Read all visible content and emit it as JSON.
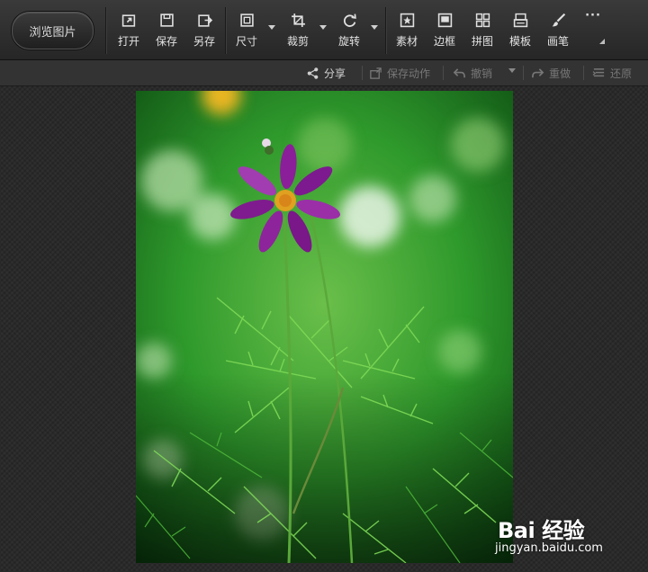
{
  "toolbar": {
    "browse_label": "浏览图片",
    "tools": [
      {
        "label": "打开",
        "icon": "open-icon"
      },
      {
        "label": "保存",
        "icon": "save-icon"
      },
      {
        "label": "另存",
        "icon": "save-as-icon"
      },
      {
        "label": "尺寸",
        "icon": "resize-icon"
      },
      {
        "label": "裁剪",
        "icon": "crop-icon"
      },
      {
        "label": "旋转",
        "icon": "rotate-icon"
      },
      {
        "label": "素材",
        "icon": "material-icon"
      },
      {
        "label": "边框",
        "icon": "border-icon"
      },
      {
        "label": "拼图",
        "icon": "collage-icon"
      },
      {
        "label": "模板",
        "icon": "template-icon"
      },
      {
        "label": "画笔",
        "icon": "brush-icon"
      }
    ],
    "more_label": "···"
  },
  "subbar": {
    "share": "分享",
    "save_action": "保存动作",
    "undo": "撤销",
    "redo": "重做",
    "restore": "还原"
  },
  "watermark": {
    "brand": "Bai 经验",
    "url": "jingyan.baidu.com"
  },
  "colors": {
    "toolbar_bg": "#2e2e2e",
    "canvas_bg": "#2a2a2a",
    "disabled_text": "#777777"
  }
}
